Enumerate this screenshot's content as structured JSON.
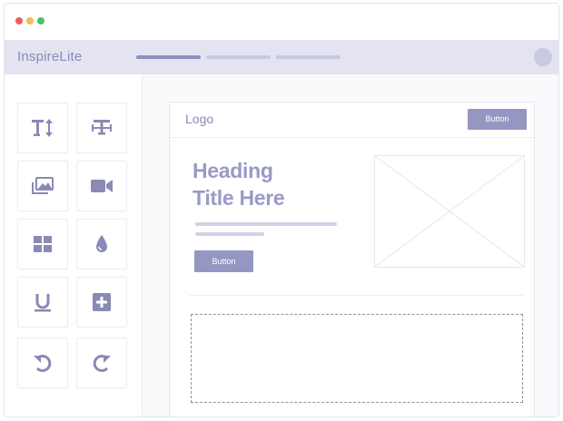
{
  "window": {
    "controls": [
      "close-dot",
      "minimize-dot",
      "zoom-dot"
    ],
    "colors": {
      "close": "#ee5f5b",
      "minimize": "#f5bd4f",
      "zoom": "#49c35a"
    }
  },
  "appbar": {
    "brand": "InspireLite",
    "progress": [
      {
        "label": "step-1",
        "state": "active"
      },
      {
        "label": "step-2",
        "state": "inactive"
      },
      {
        "label": "step-3",
        "state": "inactive"
      }
    ],
    "accent": "#8f8fc0"
  },
  "sidebar": {
    "tools": [
      {
        "icon": "text-size-icon"
      },
      {
        "icon": "text-align-icon"
      },
      {
        "icon": "image-gallery-icon"
      },
      {
        "icon": "video-camera-icon"
      },
      {
        "icon": "grid-layout-icon"
      },
      {
        "icon": "color-drop-icon"
      },
      {
        "icon": "underline-icon"
      },
      {
        "icon": "add-block-icon"
      },
      {
        "icon": "undo-icon"
      },
      {
        "icon": "redo-icon"
      }
    ]
  },
  "page": {
    "logo": "Logo",
    "header_button": "Button",
    "heading_line1": "Heading",
    "heading_line2": "Title Here",
    "hero_button": "Button",
    "image_placeholder": "image-placeholder-icon"
  }
}
